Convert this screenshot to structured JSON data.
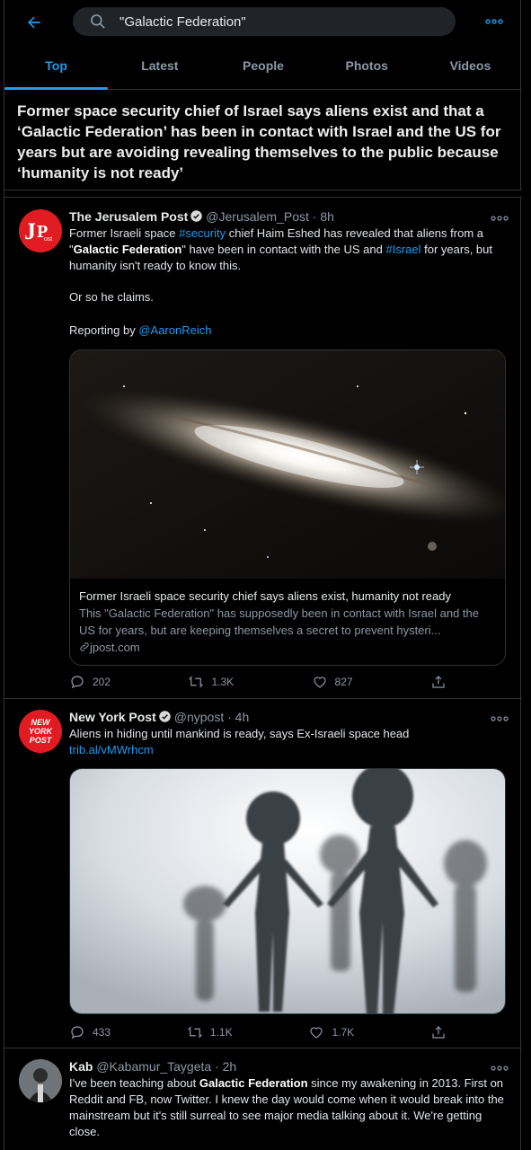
{
  "search": {
    "value": "\"Galactic Federation\""
  },
  "tabs": [
    "Top",
    "Latest",
    "People",
    "Photos",
    "Videos"
  ],
  "headline": "Former space security chief of Israel says aliens exist and that a ‘Galactic Federation’ has been in contact with Israel and the US for years but are avoiding revealing themselves to the public because ‘humanity is not ready’",
  "tweets": [
    {
      "name": "The Jerusalem Post",
      "handle": "@Jerusalem_Post",
      "time": "· 8h",
      "avatar_text": "JPost",
      "text_parts": {
        "p1a": "Former Israeli space ",
        "tag_security": "#security",
        "p1b": " chief Haim Eshed has revealed that aliens from a \"",
        "bold": "Galactic Federation",
        "p1c": "\" have been in contact with the US and ",
        "tag_israel": "#Israel",
        "p1d": " for years, but humanity isn't ready to know this.",
        "p2": "Or so he claims.",
        "p3": "Reporting by ",
        "mention": "@AaronReich"
      },
      "card": {
        "title": "Former Israeli space security chief says aliens exist, humanity not ready",
        "desc": "This \"Galactic Federation\" has supposedly been in contact with Israel and the US for years, but are keeping themselves a secret to prevent hysteri...",
        "domain": "jpost.com"
      },
      "stats": {
        "replies": "202",
        "retweets": "1.3K",
        "likes": "827"
      }
    },
    {
      "name": "New York Post",
      "handle": "@nypost",
      "time": "· 4h",
      "avatar_text": [
        "NEW",
        "YORK",
        "POST"
      ],
      "text": "Aliens in hiding until mankind is ready, says Ex-Israeli space head",
      "link": "trib.al/vMWrhcm",
      "stats": {
        "replies": "433",
        "retweets": "1.1K",
        "likes": "1.7K"
      }
    },
    {
      "name": "Kab",
      "handle": "@Kabamur_Taygeta",
      "time": "· 2h",
      "text_parts": {
        "a": "I've been teaching about ",
        "bold": "Galactic Federation",
        "b": " since my awakening in 2013. First on Reddit and FB, now Twitter. I knew the day would come when it would break into the mainstream but it's still surreal to see major media talking about it. We're getting close."
      }
    }
  ],
  "colors": {
    "accent": "#1d9bf0",
    "background": "#000000",
    "border": "#2f3336",
    "muted": "#8b98a5"
  },
  "icons": [
    "back-arrow-icon",
    "search-icon",
    "more-dots-icon",
    "verified-badge-icon",
    "reply-icon",
    "retweet-icon",
    "like-icon",
    "share-icon",
    "link-icon"
  ]
}
